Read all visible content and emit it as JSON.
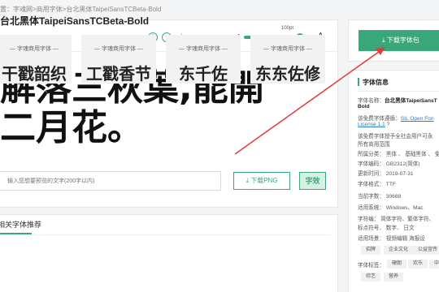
{
  "breadcrumb": "置：字魂网>商用字体>台北黑体TaipeiSansTCBeta-Bold",
  "font_header": {
    "title": "台北黑体TaipeiSansTCBeta-Bold",
    "size_small": "A",
    "size_big": "A",
    "size_label": "100pt",
    "size_progress": 0.82
  },
  "preview": {
    "line1": "解落三秋葉,能開",
    "line2": "二月花。",
    "input_placeholder": "输入您想要预览的文字(200字以内)",
    "download_png": "下载PNG",
    "style_button": "字效"
  },
  "related": {
    "title": "相关字体推荐",
    "tiles": [
      {
        "label": "— 字魂商用字体 —",
        "text": "干戳韶织"
      },
      {
        "label": "— 字魂商用字体 —",
        "text": "工戳香节"
      },
      {
        "label": "— 字魂商用字体 —",
        "text": "东千佐"
      },
      {
        "label": "— 字魂商用字体 —",
        "text": "东东佐修"
      }
    ]
  },
  "download": {
    "button": "下载字体包"
  },
  "info": {
    "title": "字体信息",
    "name_label": "字体名称：",
    "name_value": "台北黑体TaipeiSansT",
    "name_value2": "Bold",
    "license_label": "该免费字体遵循：",
    "license_link": "SIL Open Fon",
    "license_link2": "License 1.1",
    "license_note": "该免费字体授予全社会用户可永",
    "license_note2": "所有商用范围",
    "style_row": "所属分类：  黑体 、 基础黑体 、 免",
    "encoding_row": "字体编码：  GB2312(简体)",
    "date_row": "更新时间：  2019-07-31",
    "format_row": "字体格式：  TTF",
    "count_row": "当前字数：  30688",
    "system_row": "适用系统：  Windows、Mac",
    "chars_row": "字符编：  简体字符、繁体字符、",
    "chars_row2": "标点符号、  数字、  日文",
    "scene_row": "适用场景：  视频编辑     海报设",
    "tags1": [
      "招牌",
      "企业文化",
      "公益宣传"
    ],
    "tag_label": "字体标签：",
    "tags2": [
      "硬朗",
      "欢乐",
      "中"
    ],
    "tags3": [
      "综艺",
      "营养"
    ]
  },
  "colors": {
    "accent": "#3aa77a",
    "arrow": "#e23b3b"
  }
}
